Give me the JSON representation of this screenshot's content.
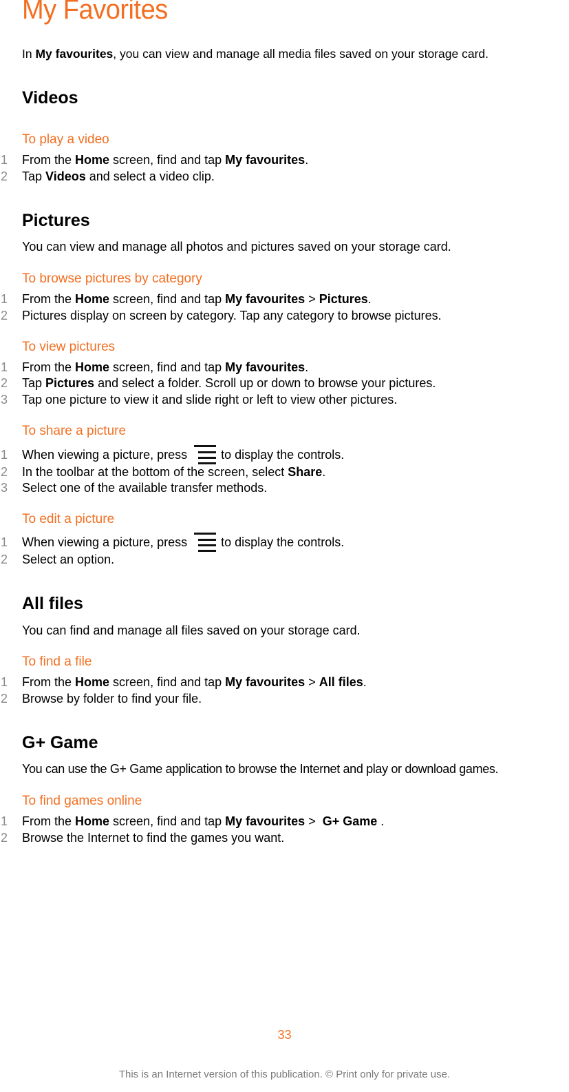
{
  "page": {
    "title": "My Favorites",
    "accent_color": "#f26f21",
    "intro": {
      "pre": "In ",
      "bold": "My favourites",
      "post": ", you can view and manage all media files saved on your storage card."
    }
  },
  "sections": {
    "videos": {
      "heading": "Videos",
      "task_play": {
        "title": "To play a video",
        "steps": [
          {
            "num": "1",
            "parts": [
              "From the ",
              "Home",
              " screen, find and tap ",
              "My favourites",
              "."
            ]
          },
          {
            "num": "2",
            "parts": [
              "Tap ",
              "Videos",
              " and select a video clip."
            ]
          }
        ]
      }
    },
    "pictures": {
      "heading": "Pictures",
      "description": "You can view and manage all photos and pictures saved on your storage card.",
      "task_browse": {
        "title": "To browse pictures by category",
        "steps": [
          {
            "num": "1",
            "parts": [
              "From the ",
              "Home",
              " screen, find and tap ",
              "My favourites",
              " > ",
              "Pictures",
              "."
            ]
          },
          {
            "num": "2",
            "text": "Pictures display on screen by category. Tap any category to browse pictures."
          }
        ]
      },
      "task_view": {
        "title": "To view pictures",
        "steps": [
          {
            "num": "1",
            "parts": [
              "From the ",
              "Home",
              " screen, find and tap ",
              "My favourites",
              "."
            ]
          },
          {
            "num": "2",
            "parts": [
              "Tap ",
              "Pictures",
              " and select a folder. Scroll up or down to browse your pictures."
            ]
          },
          {
            "num": "3",
            "text": "Tap one picture to view it and slide right or left to view other pictures."
          }
        ]
      },
      "task_share": {
        "title": "To share a picture",
        "steps": [
          {
            "num": "1",
            "pre": "When viewing a picture, press ",
            "icon": "menu-key-icon",
            "post": " to display the controls."
          },
          {
            "num": "2",
            "parts": [
              "In the toolbar at the bottom of the screen, select ",
              "Share",
              "."
            ]
          },
          {
            "num": "3",
            "text": "Select one of the available transfer methods."
          }
        ]
      },
      "task_edit": {
        "title": "To edit a picture",
        "steps": [
          {
            "num": "1",
            "pre": "When viewing a picture, press ",
            "icon": "menu-key-icon",
            "post": " to display the controls."
          },
          {
            "num": "2",
            "text": "Select an option."
          }
        ]
      }
    },
    "all_files": {
      "heading": "All files",
      "description": "You can find and manage all files saved on your storage card.",
      "task_find": {
        "title": "To find a file",
        "steps": [
          {
            "num": "1",
            "parts": [
              "From the ",
              "Home",
              " screen, find and tap ",
              "My favourites",
              " > ",
              "All files",
              "."
            ]
          },
          {
            "num": "2",
            "text": "Browse by folder to find your file."
          }
        ]
      }
    },
    "g_game": {
      "heading": "G+ Game",
      "description": "You can use the G+ Game application to browse the Internet and play or download games.",
      "task_find": {
        "title": "To find games online",
        "steps": [
          {
            "num": "1",
            "parts": [
              "From the ",
              "Home",
              " screen, find and tap ",
              "My favourites",
              " >  ",
              "G+ Game",
              " ."
            ]
          },
          {
            "num": "2",
            "text": "Browse the Internet to find the games you want."
          }
        ]
      }
    }
  },
  "footer": {
    "page_number": "33",
    "notice": "This is an Internet version of this publication. © Print only for private use."
  }
}
